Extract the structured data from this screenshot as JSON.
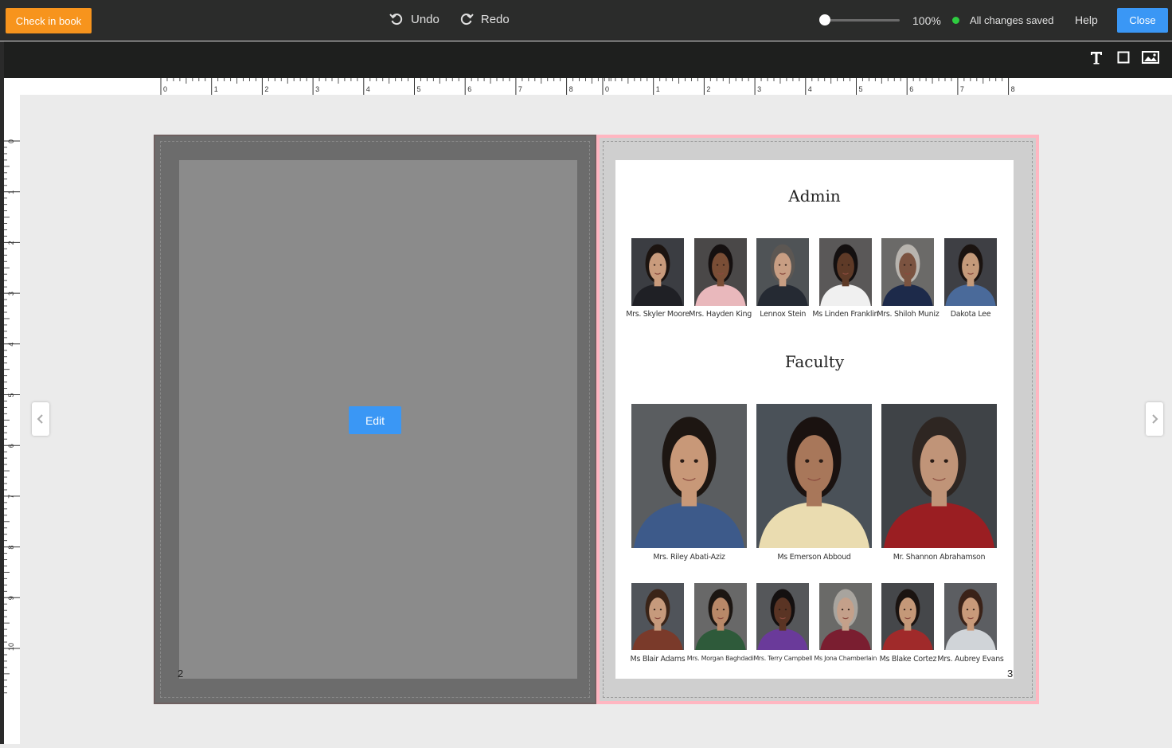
{
  "topbar": {
    "check_in_label": "Check in book",
    "undo_label": "Undo",
    "redo_label": "Redo",
    "zoom": "100%",
    "zoom_fraction": 0.0,
    "save_status": "All changes saved",
    "status_color": "#2ecc40",
    "help_label": "Help",
    "close_label": "Close"
  },
  "tools": [
    {
      "name": "text-tool-icon",
      "icon": "T"
    },
    {
      "name": "shape-tool-icon",
      "icon": "square"
    },
    {
      "name": "image-tool-icon",
      "icon": "image"
    }
  ],
  "ruler": {
    "h_left": [
      "0",
      "1",
      "2",
      "3",
      "4",
      "5",
      "6",
      "7",
      "8"
    ],
    "h_right": [
      "0",
      "1",
      "2",
      "3",
      "4",
      "5",
      "6",
      "7",
      "8"
    ],
    "v": [
      "0",
      "1",
      "2",
      "3",
      "4",
      "5",
      "6",
      "7",
      "8",
      "9",
      "10"
    ]
  },
  "left_page": {
    "edit_label": "Edit",
    "page_number": "2"
  },
  "right_page": {
    "page_number": "3",
    "admin_title": "Admin",
    "faculty_title": "Faculty",
    "admin": [
      {
        "name": "Mrs. Skyler Moore",
        "bg": "#3b3d42",
        "skin": "#c99b7c",
        "hair": "#1c1410",
        "shirt": "#1f2025"
      },
      {
        "name": "Mrs. Hayden King",
        "bg": "#4a4848",
        "skin": "#7a4e36",
        "hair": "#151010",
        "shirt": "#e9b8bc"
      },
      {
        "name": "Lennox Stein",
        "bg": "#4f5356",
        "skin": "#c89e83",
        "hair": "#5c5753",
        "shirt": "#252a33"
      },
      {
        "name": "Ms Linden Franklin",
        "bg": "#5a5858",
        "skin": "#5e3a27",
        "hair": "#141010",
        "shirt": "#f0f0f0"
      },
      {
        "name": "Mrs. Shiloh Muniz",
        "bg": "#6b6a68",
        "skin": "#7b5340",
        "hair": "#b8b4ae",
        "shirt": "#1d2a4a"
      },
      {
        "name": "Dakota Lee",
        "bg": "#3e3f44",
        "skin": "#c49a7a",
        "hair": "#1a1310",
        "shirt": "#4a6a9a"
      }
    ],
    "faculty_large": [
      {
        "name": "Mrs. Riley Abati-Aziz",
        "bg": "#5a5d60",
        "skin": "#c89878",
        "hair": "#1d1612",
        "shirt": "#3d5a8a"
      },
      {
        "name": "Ms Emerson Abboud",
        "bg": "#4a5158",
        "skin": "#a8775a",
        "hair": "#1a1210",
        "shirt": "#eadcb0"
      },
      {
        "name": "Mr. Shannon Abrahamson",
        "bg": "#3f4347",
        "skin": "#c09478",
        "hair": "#2e2622",
        "shirt": "#9a1e22"
      }
    ],
    "faculty_small": [
      {
        "name": "Ms Blair Adams",
        "bg": "#50545a",
        "skin": "#c69a7c",
        "hair": "#3a2418",
        "shirt": "#7a3a2a"
      },
      {
        "name": "Mrs. Morgan Baghdadi",
        "bg": "#686868",
        "skin": "#b88868",
        "hair": "#1c1612",
        "shirt": "#2e5a3a"
      },
      {
        "name": "Mrs. Terry Campbell",
        "bg": "#55575a",
        "skin": "#5a3424",
        "hair": "#141010",
        "shirt": "#6a3a9a"
      },
      {
        "name": "Ms Jona Chamberlain",
        "bg": "#6a6a68",
        "skin": "#c4a08a",
        "hair": "#a8a49e",
        "shirt": "#7a1e30"
      },
      {
        "name": "Ms Blake Cortez",
        "bg": "#45474a",
        "skin": "#c49878",
        "hair": "#1a1310",
        "shirt": "#a02a2a"
      },
      {
        "name": "Mrs. Aubrey Evans",
        "bg": "#5c5e62",
        "skin": "#c99a7a",
        "hair": "#3a2218",
        "shirt": "#d0d4d8"
      }
    ]
  }
}
